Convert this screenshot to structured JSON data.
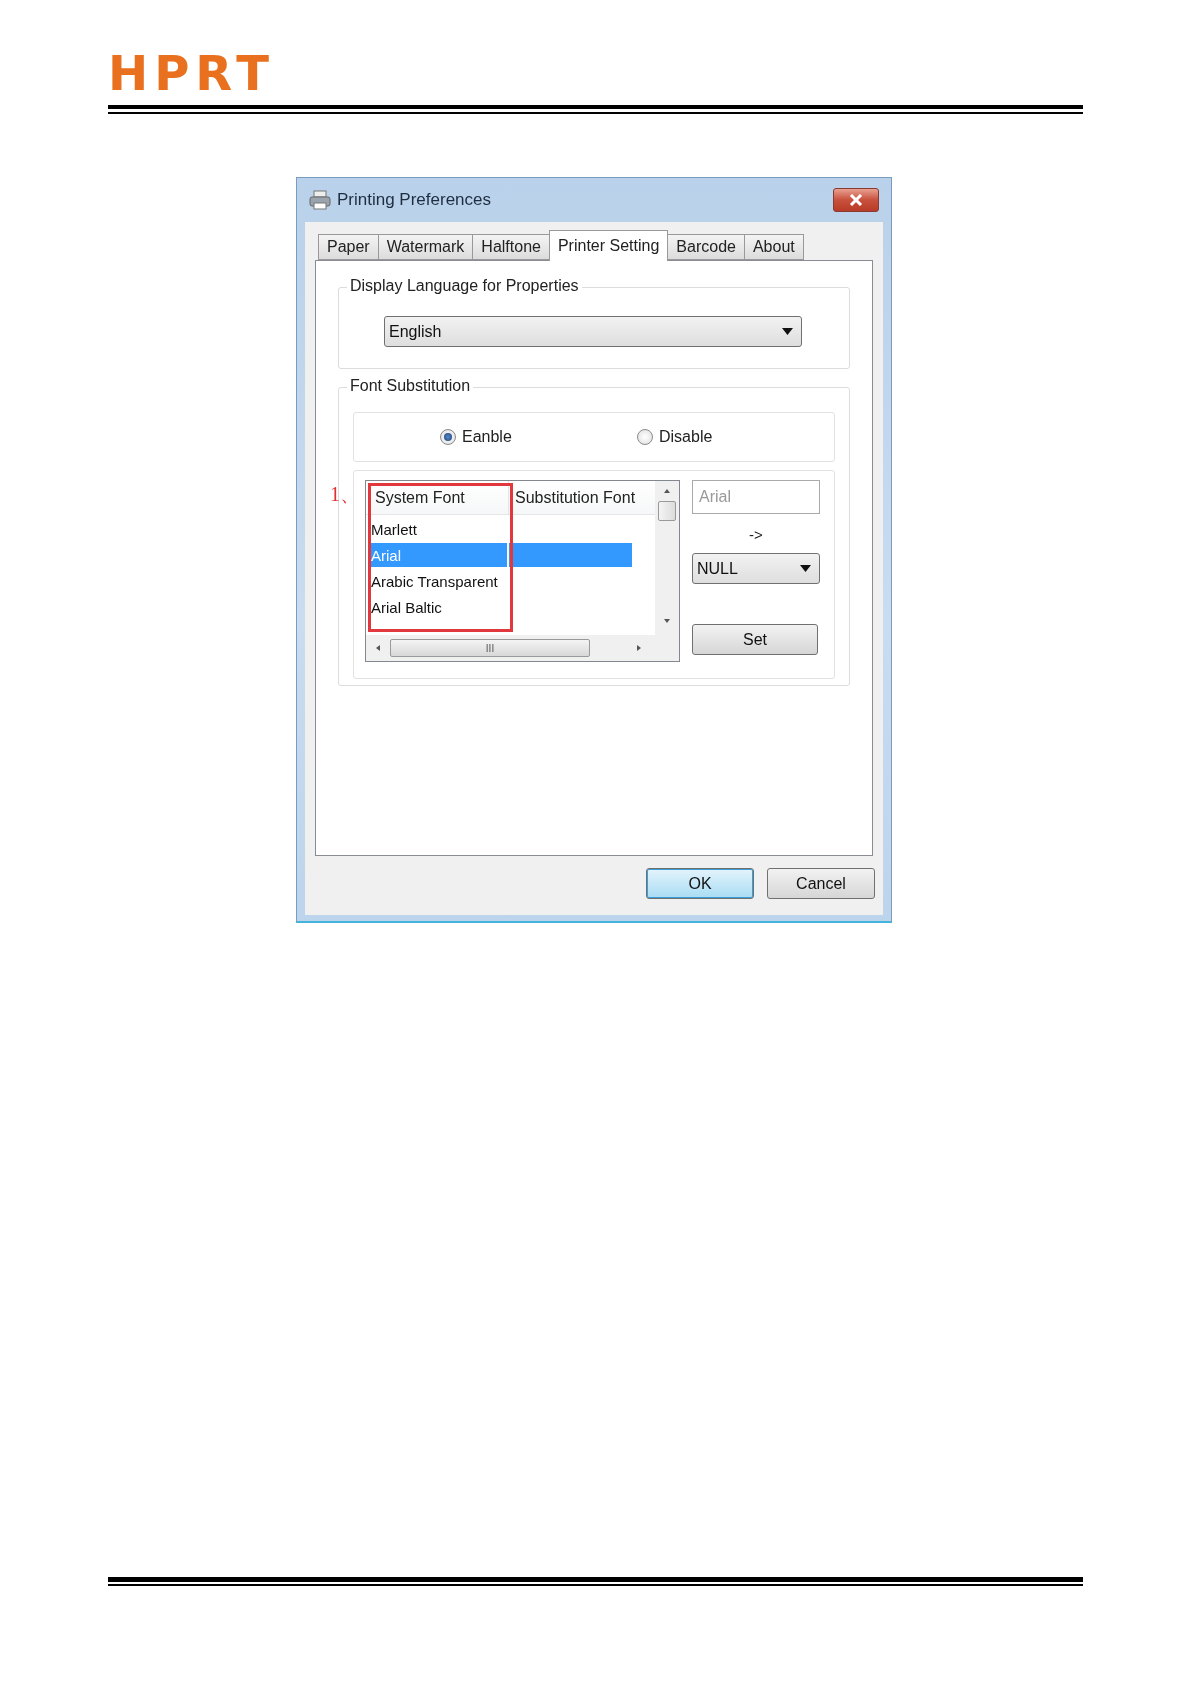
{
  "header": {
    "logo": "HPRT"
  },
  "dialog": {
    "title": "Printing Preferences",
    "tabs": [
      {
        "label": "Paper",
        "selected": false
      },
      {
        "label": "Watermark",
        "selected": false
      },
      {
        "label": "Halftone",
        "selected": false
      },
      {
        "label": "Printer Setting",
        "selected": true
      },
      {
        "label": "Barcode",
        "selected": false
      },
      {
        "label": "About",
        "selected": false
      }
    ],
    "language_group": {
      "label": "Display Language for Properties",
      "value": "English"
    },
    "font_substitution": {
      "label": "Font Substitution",
      "radios": [
        {
          "label": "Eanble",
          "selected": true
        },
        {
          "label": "Disable",
          "selected": false
        }
      ],
      "annotation": "1、",
      "table": {
        "columns": [
          "System Font",
          "Substitution Font"
        ],
        "rows": [
          {
            "system_font": "Marlett",
            "selected": false
          },
          {
            "system_font": "Arial",
            "selected": true
          },
          {
            "system_font": "Arabic Transparent",
            "selected": false
          },
          {
            "system_font": "Arial Baltic",
            "selected": false
          }
        ],
        "scroll_mark": "III"
      },
      "font_field": {
        "value": "Arial",
        "disabled": true
      },
      "arrow": "->",
      "substitute": "NULL",
      "set_button": "Set"
    },
    "buttons": [
      {
        "label": "OK",
        "default": true
      },
      {
        "label": "Cancel",
        "default": false
      }
    ]
  }
}
